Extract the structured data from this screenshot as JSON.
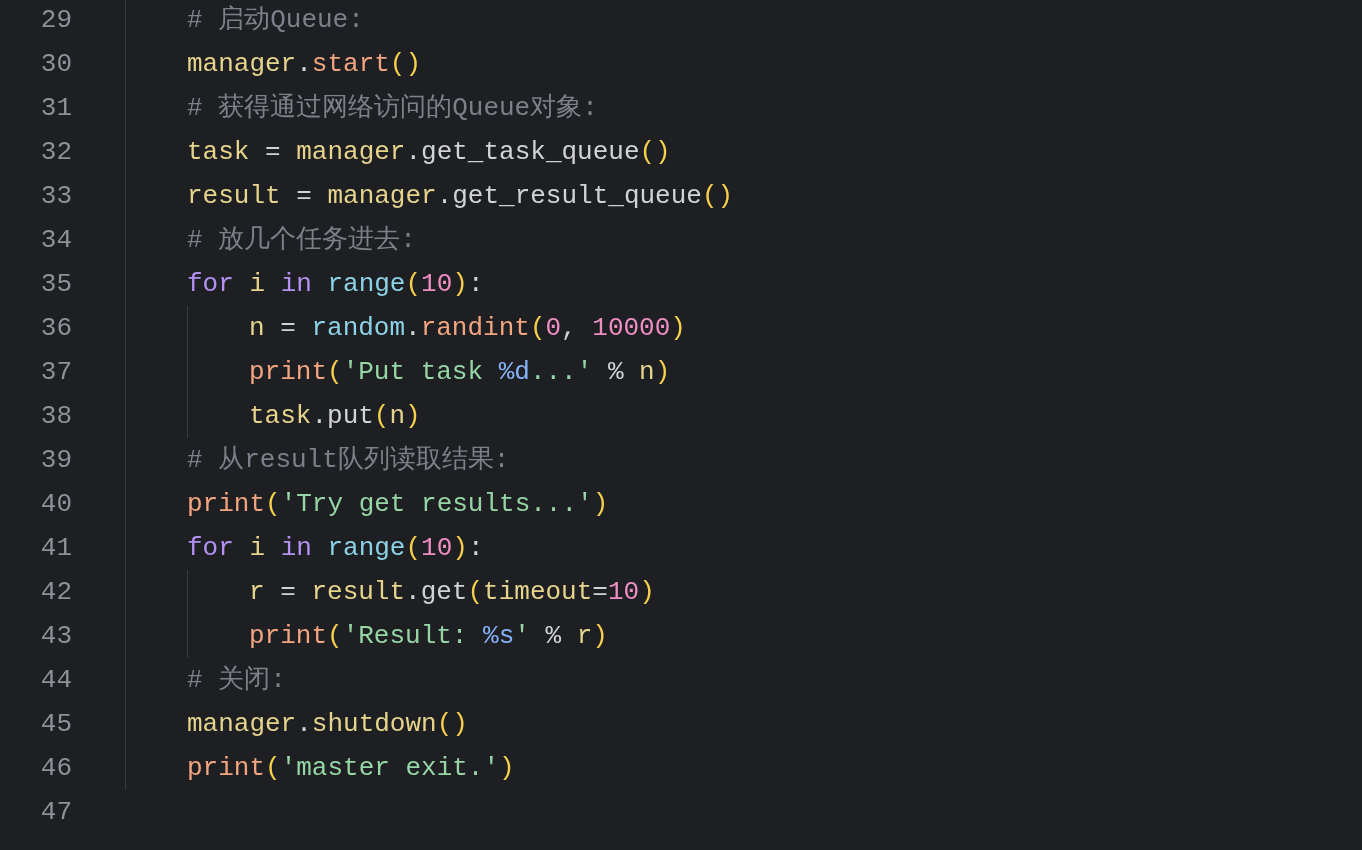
{
  "editor": {
    "lines": [
      {
        "number": "29",
        "tokens": [
          {
            "kind": "comment",
            "text": "# 启动Queue:"
          }
        ]
      },
      {
        "number": "30",
        "tokens": [
          {
            "kind": "var",
            "text": "manager"
          },
          {
            "kind": "plain",
            "text": "."
          },
          {
            "kind": "fn",
            "text": "start"
          },
          {
            "kind": "paren",
            "text": "()"
          }
        ]
      },
      {
        "number": "31",
        "tokens": [
          {
            "kind": "comment",
            "text": "# 获得通过网络访问的Queue对象:"
          }
        ]
      },
      {
        "number": "32",
        "tokens": [
          {
            "kind": "var",
            "text": "task"
          },
          {
            "kind": "plain",
            "text": " = "
          },
          {
            "kind": "var",
            "text": "manager"
          },
          {
            "kind": "plain",
            "text": ".get_task_queue"
          },
          {
            "kind": "paren",
            "text": "()"
          }
        ]
      },
      {
        "number": "33",
        "tokens": [
          {
            "kind": "var",
            "text": "result"
          },
          {
            "kind": "plain",
            "text": " = "
          },
          {
            "kind": "var",
            "text": "manager"
          },
          {
            "kind": "plain",
            "text": ".get_result_queue"
          },
          {
            "kind": "paren",
            "text": "()"
          }
        ]
      },
      {
        "number": "34",
        "tokens": [
          {
            "kind": "comment",
            "text": "# 放几个任务进去:"
          }
        ]
      },
      {
        "number": "35",
        "tokens": [
          {
            "kind": "kw",
            "text": "for "
          },
          {
            "kind": "var",
            "text": "i "
          },
          {
            "kind": "kw",
            "text": "in "
          },
          {
            "kind": "builtin",
            "text": "range"
          },
          {
            "kind": "paren",
            "text": "("
          },
          {
            "kind": "num",
            "text": "10"
          },
          {
            "kind": "paren",
            "text": ")"
          },
          {
            "kind": "plain",
            "text": ":"
          }
        ],
        "children": [
          {
            "number": "36",
            "tokens": [
              {
                "kind": "var",
                "text": "n"
              },
              {
                "kind": "plain",
                "text": " = "
              },
              {
                "kind": "builtin",
                "text": "random"
              },
              {
                "kind": "plain",
                "text": "."
              },
              {
                "kind": "fn",
                "text": "randint"
              },
              {
                "kind": "paren",
                "text": "("
              },
              {
                "kind": "num",
                "text": "0"
              },
              {
                "kind": "plain",
                "text": ", "
              },
              {
                "kind": "num",
                "text": "10000"
              },
              {
                "kind": "paren",
                "text": ")"
              }
            ]
          },
          {
            "number": "37",
            "tokens": [
              {
                "kind": "fn",
                "text": "print"
              },
              {
                "kind": "paren",
                "text": "("
              },
              {
                "kind": "str",
                "text": "'Put task "
              },
              {
                "kind": "fmt",
                "text": "%d"
              },
              {
                "kind": "str",
                "text": "...'"
              },
              {
                "kind": "plain",
                "text": " % "
              },
              {
                "kind": "var",
                "text": "n"
              },
              {
                "kind": "paren",
                "text": ")"
              }
            ]
          },
          {
            "number": "38",
            "tokens": [
              {
                "kind": "var",
                "text": "task"
              },
              {
                "kind": "plain",
                "text": ".put"
              },
              {
                "kind": "paren",
                "text": "("
              },
              {
                "kind": "var",
                "text": "n"
              },
              {
                "kind": "paren",
                "text": ")"
              }
            ]
          }
        ]
      },
      {
        "number": "39",
        "tokens": [
          {
            "kind": "comment",
            "text": "# 从result队列读取结果:"
          }
        ]
      },
      {
        "number": "40",
        "tokens": [
          {
            "kind": "fn",
            "text": "print"
          },
          {
            "kind": "paren",
            "text": "("
          },
          {
            "kind": "str",
            "text": "'Try get results...'"
          },
          {
            "kind": "paren",
            "text": ")"
          }
        ]
      },
      {
        "number": "41",
        "tokens": [
          {
            "kind": "kw",
            "text": "for "
          },
          {
            "kind": "var",
            "text": "i "
          },
          {
            "kind": "kw",
            "text": "in "
          },
          {
            "kind": "builtin",
            "text": "range"
          },
          {
            "kind": "paren",
            "text": "("
          },
          {
            "kind": "num",
            "text": "10"
          },
          {
            "kind": "paren",
            "text": ")"
          },
          {
            "kind": "plain",
            "text": ":"
          }
        ],
        "children": [
          {
            "number": "42",
            "tokens": [
              {
                "kind": "var",
                "text": "r"
              },
              {
                "kind": "plain",
                "text": " = "
              },
              {
                "kind": "var",
                "text": "result"
              },
              {
                "kind": "plain",
                "text": ".get"
              },
              {
                "kind": "paren",
                "text": "("
              },
              {
                "kind": "var",
                "text": "timeout"
              },
              {
                "kind": "plain",
                "text": "="
              },
              {
                "kind": "num",
                "text": "10"
              },
              {
                "kind": "paren",
                "text": ")"
              }
            ]
          },
          {
            "number": "43",
            "tokens": [
              {
                "kind": "fn",
                "text": "print"
              },
              {
                "kind": "paren",
                "text": "("
              },
              {
                "kind": "str",
                "text": "'Result: "
              },
              {
                "kind": "fmt",
                "text": "%s"
              },
              {
                "kind": "str",
                "text": "'"
              },
              {
                "kind": "plain",
                "text": " % "
              },
              {
                "kind": "var",
                "text": "r"
              },
              {
                "kind": "paren",
                "text": ")"
              }
            ]
          }
        ]
      },
      {
        "number": "44",
        "tokens": [
          {
            "kind": "comment",
            "text": "# 关闭:"
          }
        ]
      },
      {
        "number": "45",
        "tokens": [
          {
            "kind": "var",
            "text": "manager"
          },
          {
            "kind": "plain",
            "text": "."
          },
          {
            "kind": "var",
            "text": "shutdown"
          },
          {
            "kind": "paren",
            "text": "()"
          }
        ]
      },
      {
        "number": "46",
        "tokens": [
          {
            "kind": "fn",
            "text": "print"
          },
          {
            "kind": "paren",
            "text": "("
          },
          {
            "kind": "str",
            "text": "'master exit.'"
          },
          {
            "kind": "paren",
            "text": ")"
          }
        ]
      },
      {
        "number": "47"
      }
    ]
  }
}
